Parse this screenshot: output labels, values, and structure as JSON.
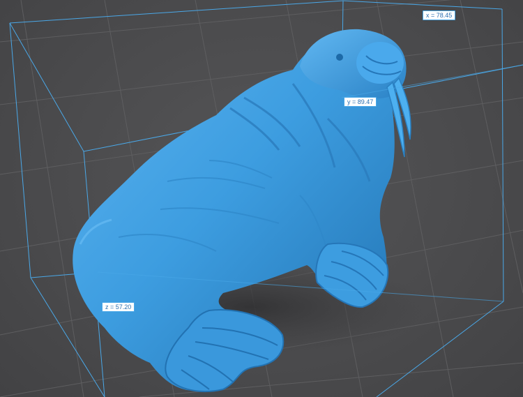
{
  "viewport": {
    "background_color": "#4b4b4d",
    "grid_color": "#5e5e60",
    "bounding_box_color": "#4aa8e8",
    "model_color": "#3d9de0",
    "model_name": "walrus-model"
  },
  "dimensions": {
    "x_label": "x = 78.45",
    "y_label": "y = 89.47",
    "z_label": "z = 57.20"
  }
}
